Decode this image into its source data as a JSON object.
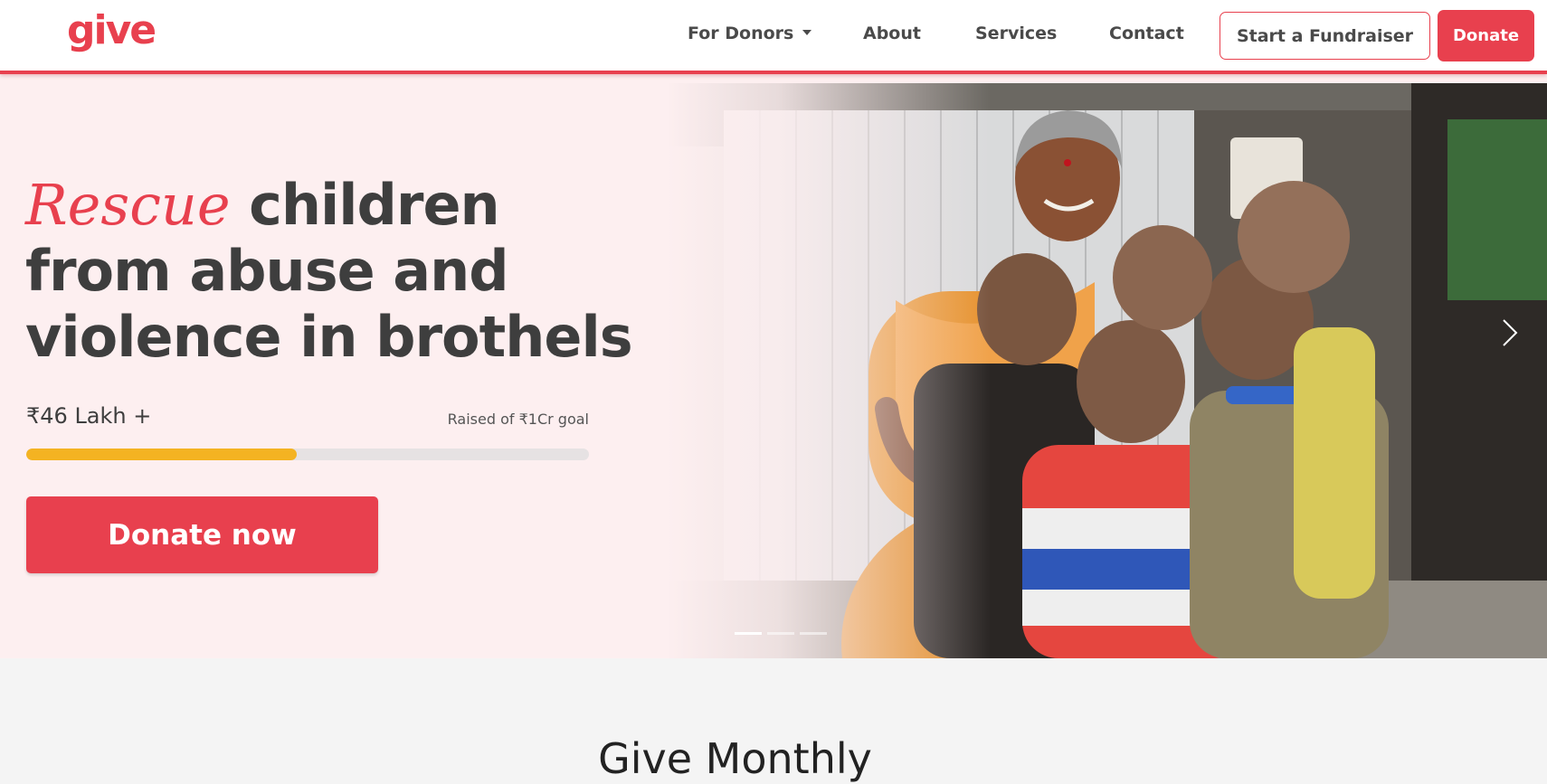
{
  "nav": {
    "logo": "give",
    "for_donors": "For Donors",
    "about": "About",
    "services": "Services",
    "contact": "Contact",
    "start_fundraiser": "Start a Fundraiser",
    "donate": "Donate"
  },
  "hero": {
    "headline_accent": "Rescue",
    "headline_rest": " children from abuse and violence in brothels",
    "raised_amount": "₹46 Lakh +",
    "raised_goal": "Raised of ₹1Cr goal",
    "progress": 0.48,
    "cta": "Donate now",
    "slide_count": 3,
    "active_slide": 0
  },
  "section": {
    "title": "Give Monthly"
  },
  "colors": {
    "brand": "#e8404e",
    "progress": "#f4b322",
    "hero_bg": "#fdeff0",
    "text": "#3e3e3e"
  }
}
